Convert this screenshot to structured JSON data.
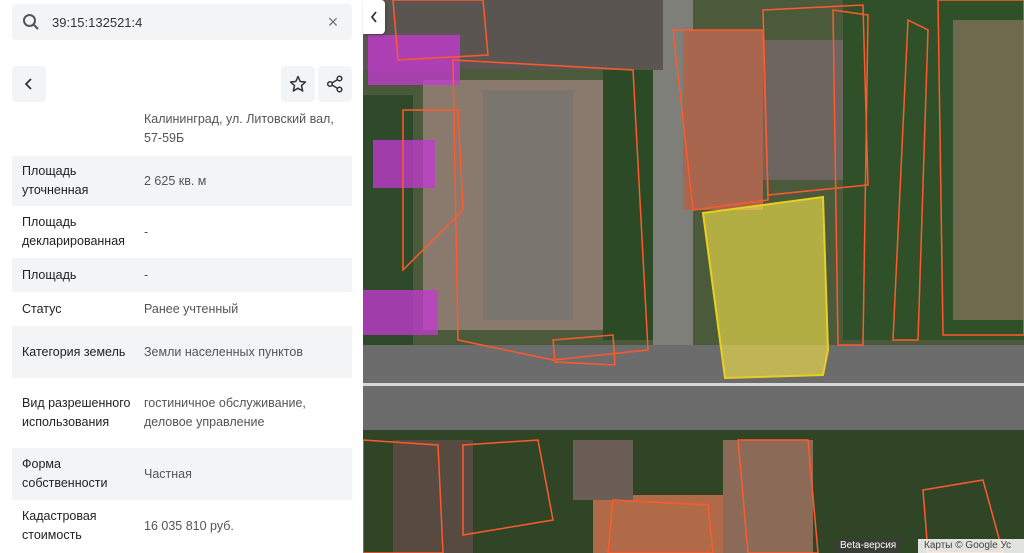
{
  "search": {
    "value": "39:15:132521:4"
  },
  "toolbar": {
    "back": "back-icon",
    "favorite": "star-icon",
    "share": "share-icon"
  },
  "address": "Калининград, ул. Литовский вал, 57-59Б",
  "properties": [
    {
      "label": "Площадь уточненная",
      "value": "2 625 кв. м"
    },
    {
      "label": "Площадь декларированная",
      "value": "-"
    },
    {
      "label": "Площадь",
      "value": "-"
    },
    {
      "label": "Статус",
      "value": "Ранее учтенный"
    },
    {
      "label": "Категория земель",
      "value": "Земли населенных пунктов"
    },
    {
      "label": "Вид разрешенного использования",
      "value": "гостиничное обслуживание, деловое управление"
    },
    {
      "label": "Форма собственности",
      "value": "Частная"
    },
    {
      "label": "Кадастровая стоимость",
      "value": "16 035 810 руб."
    }
  ],
  "map": {
    "beta_label": "Beta-версия",
    "attribution": "Карты © Google  Ус",
    "colors": {
      "selected": "#f2e24a",
      "parcel": "#ff5a2b",
      "other": "#c23ad0"
    }
  }
}
